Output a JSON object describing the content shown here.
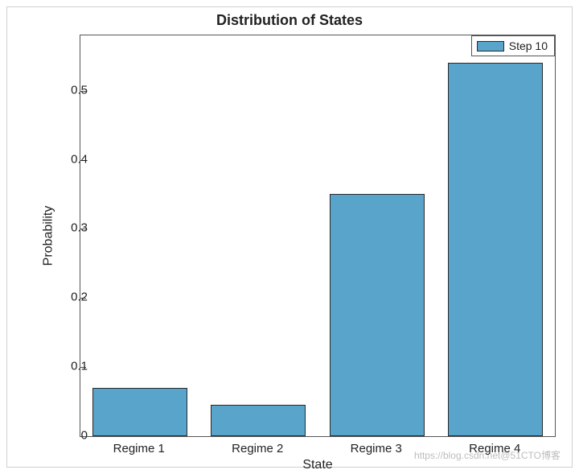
{
  "chart_data": {
    "type": "bar",
    "title": "Distribution of States",
    "xlabel": "State",
    "ylabel": "Probability",
    "categories": [
      "Regime 1",
      "Regime 2",
      "Regime 3",
      "Regime 4"
    ],
    "values": [
      0.07,
      0.045,
      0.35,
      0.54
    ],
    "ylim": [
      0,
      0.58
    ],
    "yticks": [
      0,
      0.1,
      0.2,
      0.3,
      0.4,
      0.5
    ],
    "legend": {
      "label": "Step 10",
      "position": "top-right-inside"
    },
    "bar_color": "#58a4ca",
    "edge_color": "#2a2a2a"
  },
  "watermark": "https://blog.csdn.net@51CTO博客"
}
